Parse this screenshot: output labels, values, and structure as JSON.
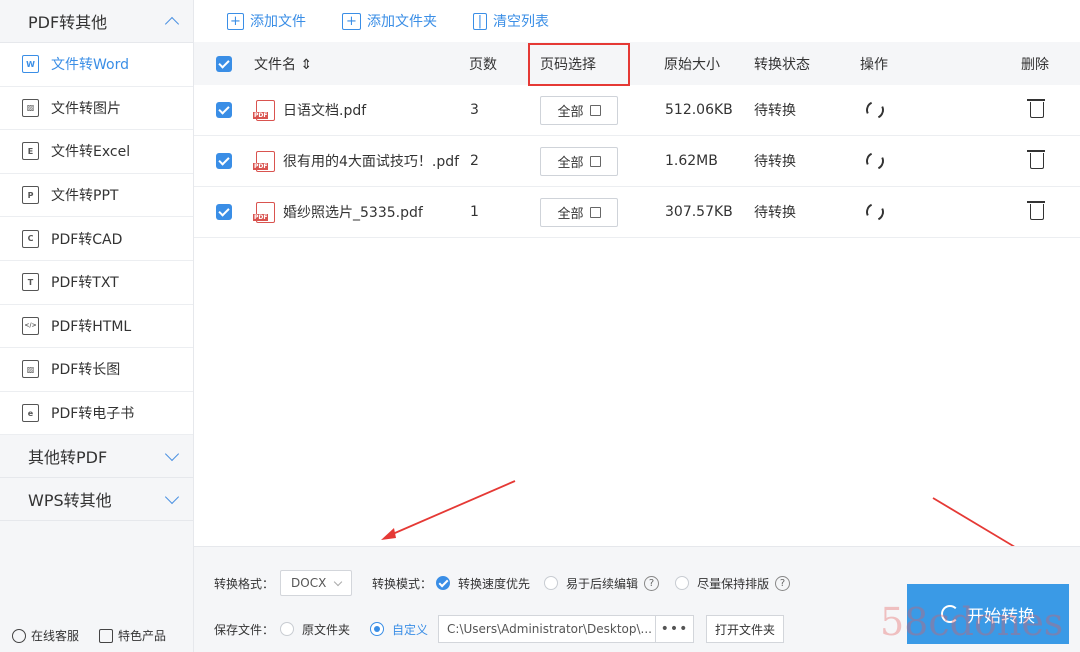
{
  "sidebar": {
    "group_pdf": "PDF转其他",
    "items": [
      {
        "label": "文件转Word",
        "icon": "W"
      },
      {
        "label": "文件转图片",
        "icon": "▨"
      },
      {
        "label": "文件转Excel",
        "icon": "E"
      },
      {
        "label": "文件转PPT",
        "icon": "P"
      },
      {
        "label": "PDF转CAD",
        "icon": "C"
      },
      {
        "label": "PDF转TXT",
        "icon": "T"
      },
      {
        "label": "PDF转HTML",
        "icon": "</>"
      },
      {
        "label": "PDF转长图",
        "icon": "▨"
      },
      {
        "label": "PDF转电子书",
        "icon": "e"
      }
    ],
    "group_other": "其他转PDF",
    "group_wps": "WPS转其他",
    "footer": {
      "service": "在线客服",
      "products": "特色产品"
    }
  },
  "toolbar": {
    "add_file": "添加文件",
    "add_folder": "添加文件夹",
    "clear": "清空列表"
  },
  "table": {
    "headers": {
      "name": "文件名 ⇕",
      "pages": "页数",
      "page_select": "页码选择",
      "size": "原始大小",
      "status": "转换状态",
      "action": "操作",
      "delete": "删除"
    },
    "rows": [
      {
        "name": "日语文档.pdf",
        "pages": "3",
        "range": "全部",
        "size": "512.06KB",
        "status": "待转换"
      },
      {
        "name": "很有用的4大面试技巧！.pdf",
        "pages": "2",
        "range": "全部",
        "size": "1.62MB",
        "status": "待转换"
      },
      {
        "name": "婚纱照选片_5335.pdf",
        "pages": "1",
        "range": "全部",
        "size": "307.57KB",
        "status": "待转换"
      }
    ]
  },
  "options": {
    "format_label": "转换格式：",
    "format_value": "DOCX",
    "mode_label": "转换模式：",
    "modes": [
      "转换速度优先",
      "易于后续编辑",
      "尽量保持排版"
    ],
    "save_label": "保存文件：",
    "save_original": "原文件夹",
    "save_custom": "自定义",
    "path": "C:\\Users\\Administrator\\Desktop\\...",
    "path_dots": "•••",
    "open_folder": "打开文件夹"
  },
  "start_button": "开始转换",
  "watermark": "58cdones"
}
